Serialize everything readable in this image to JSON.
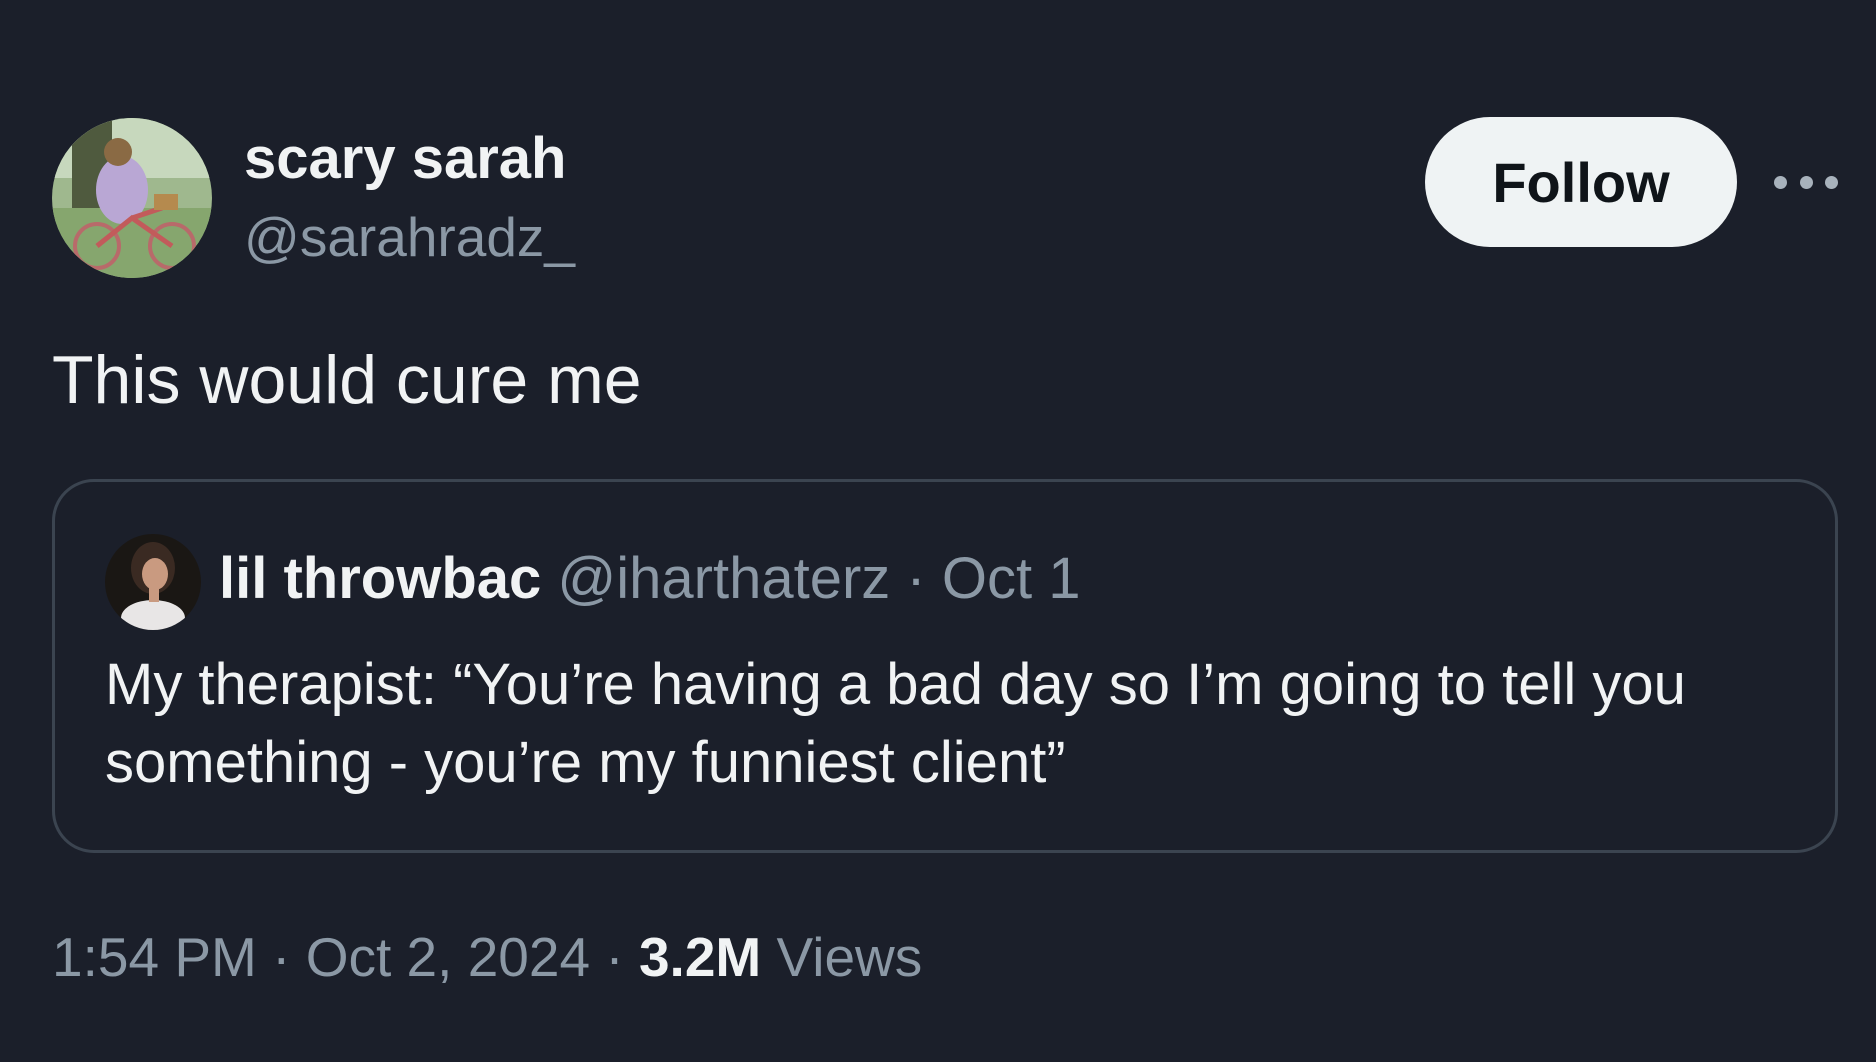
{
  "author": {
    "display_name": "scary sarah",
    "handle": "@sarahradz_",
    "avatar_icon": "avatar-photo"
  },
  "actions": {
    "follow_label": "Follow",
    "more_icon": "more-horizontal-icon"
  },
  "tweet": {
    "text": "This would cure me"
  },
  "quoted_tweet": {
    "display_name": "lil throwbac",
    "handle": "@iharthaterz",
    "separator": "·",
    "date": "Oct 1",
    "text": "My therapist: “You’re having a bad day so I’m going to tell you something - you’re my funniest client”"
  },
  "meta": {
    "time": "1:54 PM",
    "separator": "·",
    "date": "Oct 2, 2024",
    "views_count": "3.2M",
    "views_label": "Views"
  },
  "colors": {
    "background": "#1b1f2a",
    "primary_text": "#f1f3f4",
    "secondary_text": "#8b98a5",
    "follow_button_bg": "#eff3f4",
    "border": "#3b4450"
  }
}
